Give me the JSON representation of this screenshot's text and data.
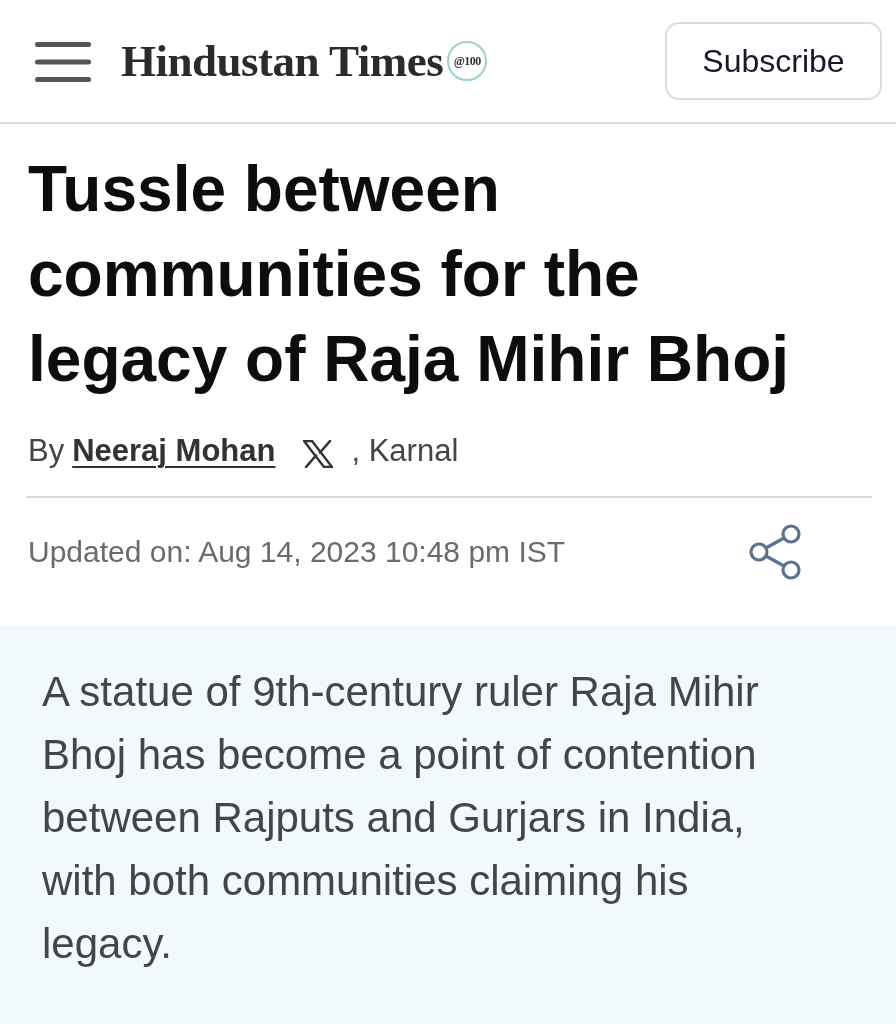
{
  "header": {
    "logo": {
      "wordmark": "Hindustan Times",
      "badge": "@100"
    },
    "subscribe_button": "Subscribe"
  },
  "article": {
    "headline": "Tussle between communities for the legacy of Raja Mihir Bhoj",
    "byline": {
      "prefix": "By",
      "author": "Neeraj Mohan",
      "location": ", Karnal"
    },
    "updated": "Updated on: Aug 14, 2023 10:48 pm IST",
    "summary": "A statue of 9th-century ruler Raja Mihir Bhoj has become a point of contention between Rajputs and Gurjars in India, with both communities claiming his legacy."
  }
}
